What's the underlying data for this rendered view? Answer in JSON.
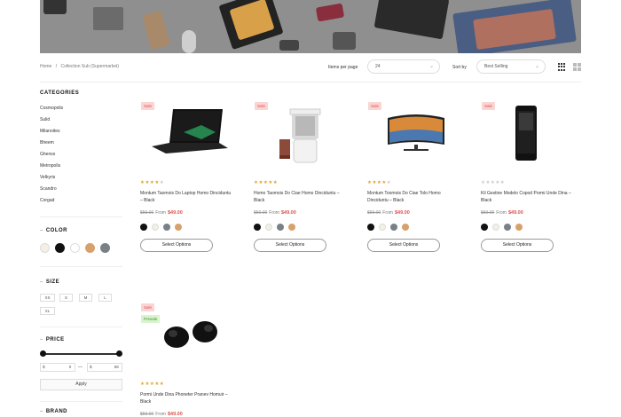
{
  "breadcrumb": [
    "Home",
    "/",
    "Collection Sub (Supermarket)"
  ],
  "toolbar": {
    "items_per_page_label": "Items per page",
    "items_per_page_value": "24",
    "sort_label": "Sort by",
    "sort_value": "Best Selling"
  },
  "sidebar": {
    "categories_title": "CATEGORIES",
    "categories": [
      "Cosmopolis",
      "Sulid",
      "Milanoites",
      "Bheem",
      "Ghenss",
      "Metropolis",
      "Velkyris",
      "Scandro",
      "Corgad"
    ],
    "color_title": "COLOR",
    "colors": [
      "#f3efe2",
      "#111111",
      "#ffffff",
      "#d8a16b",
      "#7a8088"
    ],
    "size_title": "SIZE",
    "sizes": [
      "XS",
      "S",
      "M",
      "L",
      "XL"
    ],
    "price_title": "PRICE",
    "price_min": "$",
    "price_min_val": "0",
    "price_dash": "—",
    "price_max": "$",
    "price_max_val": "68",
    "apply_label": "Apply",
    "brand_title": "BRAND"
  },
  "products": [
    {
      "badges": [
        "Sale"
      ],
      "rating": 4,
      "stars": "★★★★★",
      "name": "Montum Taomois Do Laptop Homo Dinciduntu – Black",
      "old_price": "$59.00",
      "from": "From",
      "new_price": "$49.00",
      "swatches": [
        "#111111",
        "#f3efe2",
        "#7a8088",
        "#d8a16b"
      ],
      "button": "Select Options",
      "image": "laptop"
    },
    {
      "badges": [
        "Sale"
      ],
      "rating": 5,
      "stars": "★★★★★",
      "name": "Homo Taomois Do Ciae Homo Dinciduntu – Black",
      "old_price": "$59.00",
      "from": "From",
      "new_price": "$49.00",
      "swatches": [
        "#111111",
        "#f3efe2",
        "#7a8088",
        "#d8a16b"
      ],
      "button": "Select Options",
      "image": "juicer"
    },
    {
      "badges": [
        "Sale"
      ],
      "rating": 4,
      "stars": "★★★★★",
      "name": "Montum Toomois Do Ciae Tolo Homo Dinciduntu – Black",
      "old_price": "$59.00",
      "from": "From",
      "new_price": "$49.00",
      "swatches": [
        "#111111",
        "#f3efe2",
        "#7a8088",
        "#d8a16b"
      ],
      "button": "Select Options",
      "image": "tv"
    },
    {
      "badges": [
        "Sale"
      ],
      "rating": 0,
      "stars": "★★★★★",
      "name": "Kil Gestine Modelo Copod Pormi Unde Dina – Black",
      "old_price": "$59.00",
      "from": "From",
      "new_price": "$49.00",
      "swatches": [
        "#111111",
        "#f3efe2",
        "#7a8088",
        "#d8a16b"
      ],
      "button": "Select Options",
      "image": "phone"
    },
    {
      "badges": [
        "Sale",
        "Presale"
      ],
      "rating": 5,
      "stars": "★★★★★",
      "name": "Pormi Unde Dina Phoneter Pranev Homuir – Black",
      "old_price": "$59.00",
      "from": "From",
      "new_price": "$49.00",
      "swatches": [],
      "button": "",
      "image": "earbuds"
    }
  ],
  "colors": {
    "sale": "#d9534f",
    "star": "#e0a82e",
    "star_empty": "#ccc"
  }
}
